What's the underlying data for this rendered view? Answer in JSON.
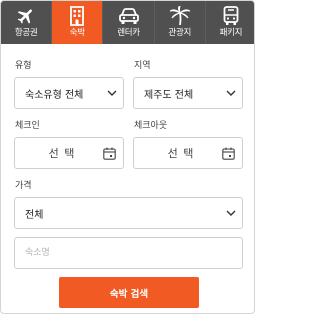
{
  "tabs": [
    {
      "label": "항공권",
      "icon": "airplane-icon",
      "active": false
    },
    {
      "label": "숙박",
      "icon": "hotel-icon",
      "active": true
    },
    {
      "label": "렌터카",
      "icon": "car-icon",
      "active": false
    },
    {
      "label": "관광지",
      "icon": "palm-tree-icon",
      "active": false
    },
    {
      "label": "패키지",
      "icon": "bus-icon",
      "active": false
    }
  ],
  "form": {
    "type_label": "유형",
    "type_value": "숙소유형 전체",
    "region_label": "지역",
    "region_value": "제주도 전체",
    "checkin_label": "체크인",
    "checkin_value": "선 택",
    "checkout_label": "체크아웃",
    "checkout_value": "선 택",
    "price_label": "가격",
    "price_value": "전체",
    "name_placeholder": "숙소명",
    "search_button": "숙박 검색"
  },
  "colors": {
    "accent": "#f15a22",
    "tab_bar": "#505050"
  }
}
